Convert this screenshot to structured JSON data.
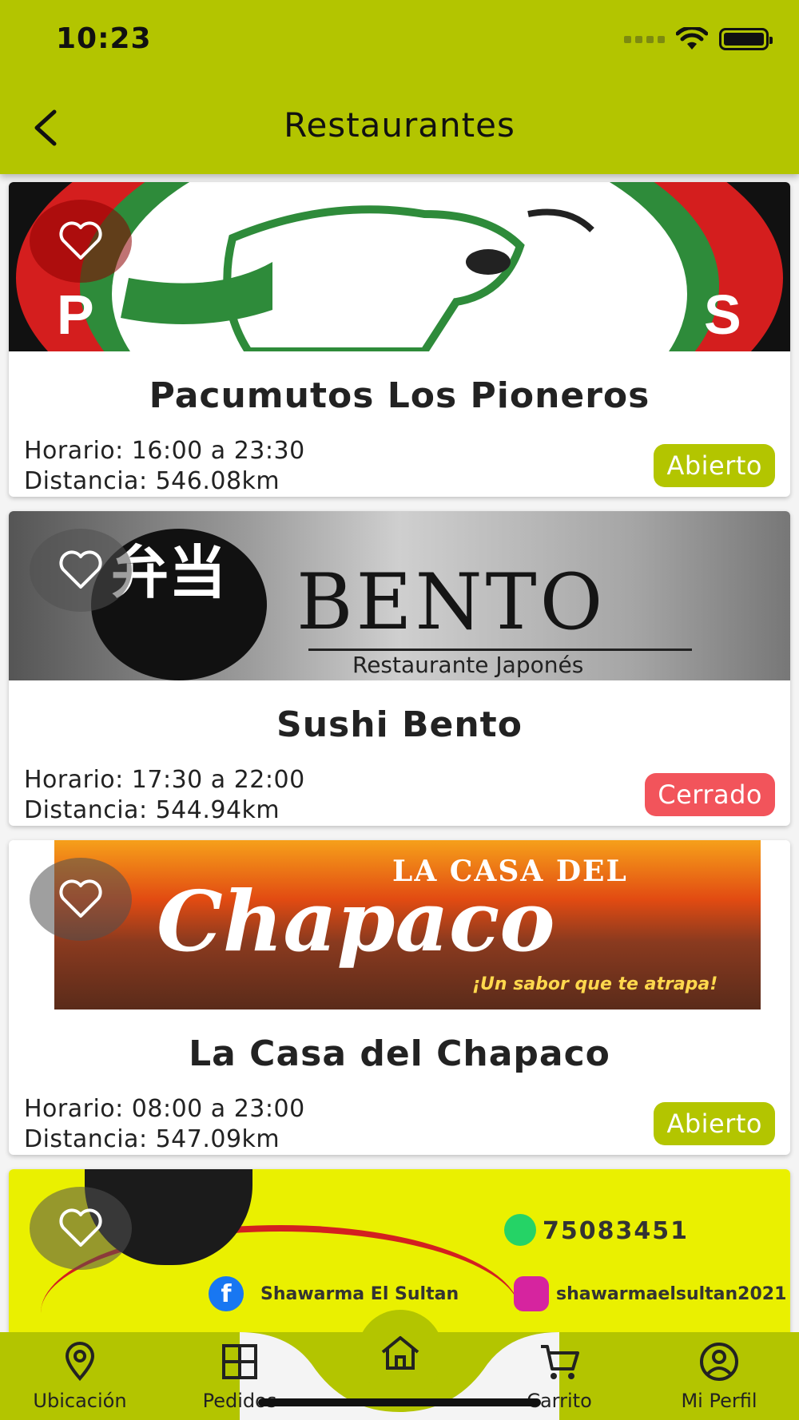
{
  "status_bar": {
    "time": "10:23"
  },
  "header": {
    "title": "Restaurantes"
  },
  "labels": {
    "hours_prefix": "Horario: ",
    "distance_prefix": "Distancia: "
  },
  "restaurants": [
    {
      "name": "Pacumutos Los Pioneros",
      "hours": "Horario: 16:00 a 23:30",
      "distance": "Distancia: 546.08km",
      "status": "Abierto",
      "is_open": true
    },
    {
      "name": "Sushi Bento",
      "hours": "Horario: 17:30 a 22:00",
      "distance": "Distancia: 544.94km",
      "status": "Cerrado",
      "is_open": false
    },
    {
      "name": "La Casa del Chapaco",
      "hours": "Horario: 08:00 a 23:00",
      "distance": "Distancia: 547.09km",
      "status": "Abierto",
      "is_open": true
    },
    {
      "name": "",
      "hours": "",
      "distance": "",
      "status": "",
      "is_open": null
    }
  ],
  "images": {
    "bento": {
      "kanji": "弁当",
      "word": "BENTO",
      "subtitle": "Restaurante Japonés"
    },
    "chapaco": {
      "top": "LA CASA DEL",
      "script": "Chapaco",
      "tagline": "¡Un sabor que te atrapa!"
    },
    "sultan": {
      "phone": "75083451",
      "facebook": "Shawarma El Sultan",
      "instagram": "shawarmaelsultan2021"
    }
  },
  "nav": {
    "items": [
      {
        "label": "Ubicación",
        "icon": "location-pin-icon"
      },
      {
        "label": "Pedidos",
        "icon": "grid-icon"
      },
      {
        "label": "",
        "icon": "home-icon"
      },
      {
        "label": "Carrito",
        "icon": "cart-icon"
      },
      {
        "label": "Mi Perfil",
        "icon": "profile-icon"
      }
    ]
  },
  "colors": {
    "accent": "#b3c500",
    "open": "#b3c500",
    "closed": "#f2545b"
  }
}
